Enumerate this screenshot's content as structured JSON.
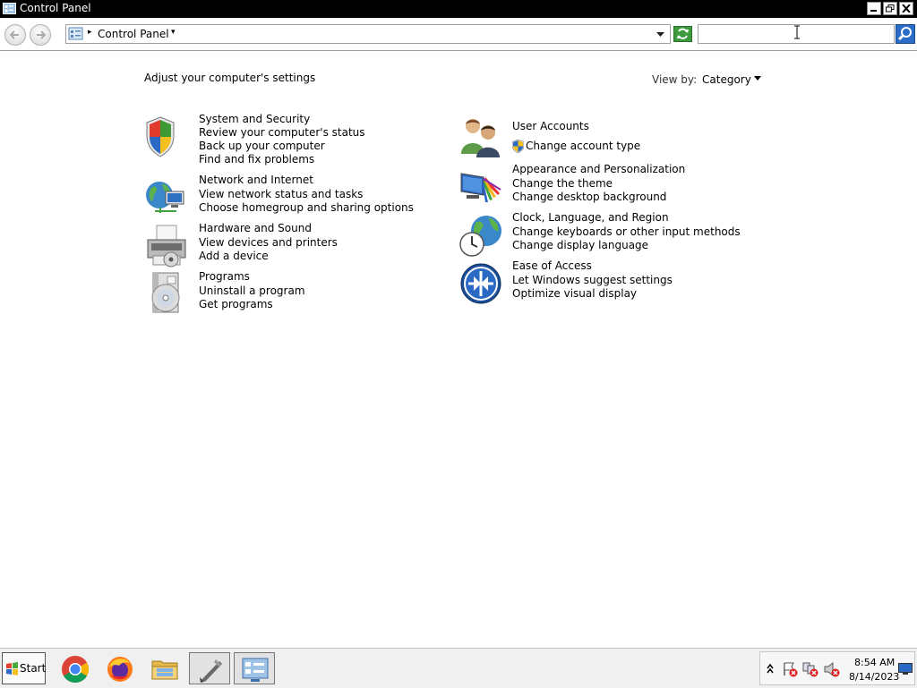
{
  "window": {
    "title": "Control Panel"
  },
  "address": {
    "breadcrumb": "Control Panel",
    "search_placeholder": ""
  },
  "content": {
    "heading": "Adjust your computer's settings",
    "view_by_label": "View by:",
    "view_by_value": "Category"
  },
  "categories_left": [
    {
      "title": "System and Security",
      "icon": "shield-icon",
      "links": [
        "Review your computer's status",
        "Back up your computer",
        "Find and fix problems"
      ]
    },
    {
      "title": "Network and Internet",
      "icon": "network-globe-icon",
      "links": [
        "View network status and tasks",
        "Choose homegroup and sharing options"
      ]
    },
    {
      "title": "Hardware and Sound",
      "icon": "printer-icon",
      "links": [
        "View devices and printers",
        "Add a device"
      ]
    },
    {
      "title": "Programs",
      "icon": "programs-disc-icon",
      "links": [
        "Uninstall a program",
        "Get programs"
      ]
    }
  ],
  "categories_right": [
    {
      "title": "User Accounts",
      "icon": "users-icon",
      "links": [
        "Change account type"
      ]
    },
    {
      "title": "Appearance and Personalization",
      "icon": "monitor-palette-icon",
      "links": [
        "Change the theme",
        "Change desktop background"
      ]
    },
    {
      "title": "Clock, Language, and Region",
      "icon": "clock-globe-icon",
      "links": [
        "Change keyboards or other input methods",
        "Change display language"
      ]
    },
    {
      "title": "Ease of Access",
      "icon": "ease-of-access-icon",
      "links": [
        "Let Windows suggest settings",
        "Optimize visual display"
      ]
    }
  ],
  "taskbar": {
    "start_label": "Start",
    "apps": [
      "chrome-icon",
      "firefox-icon",
      "file-explorer-icon",
      "taskbar-app-4-icon",
      "control-panel-icon"
    ],
    "time": "8:54 AM",
    "date": "8/14/2023"
  },
  "colors": {
    "titlebar": "#000000",
    "link": "#000000",
    "accent_blue": "#2a6cc7"
  }
}
